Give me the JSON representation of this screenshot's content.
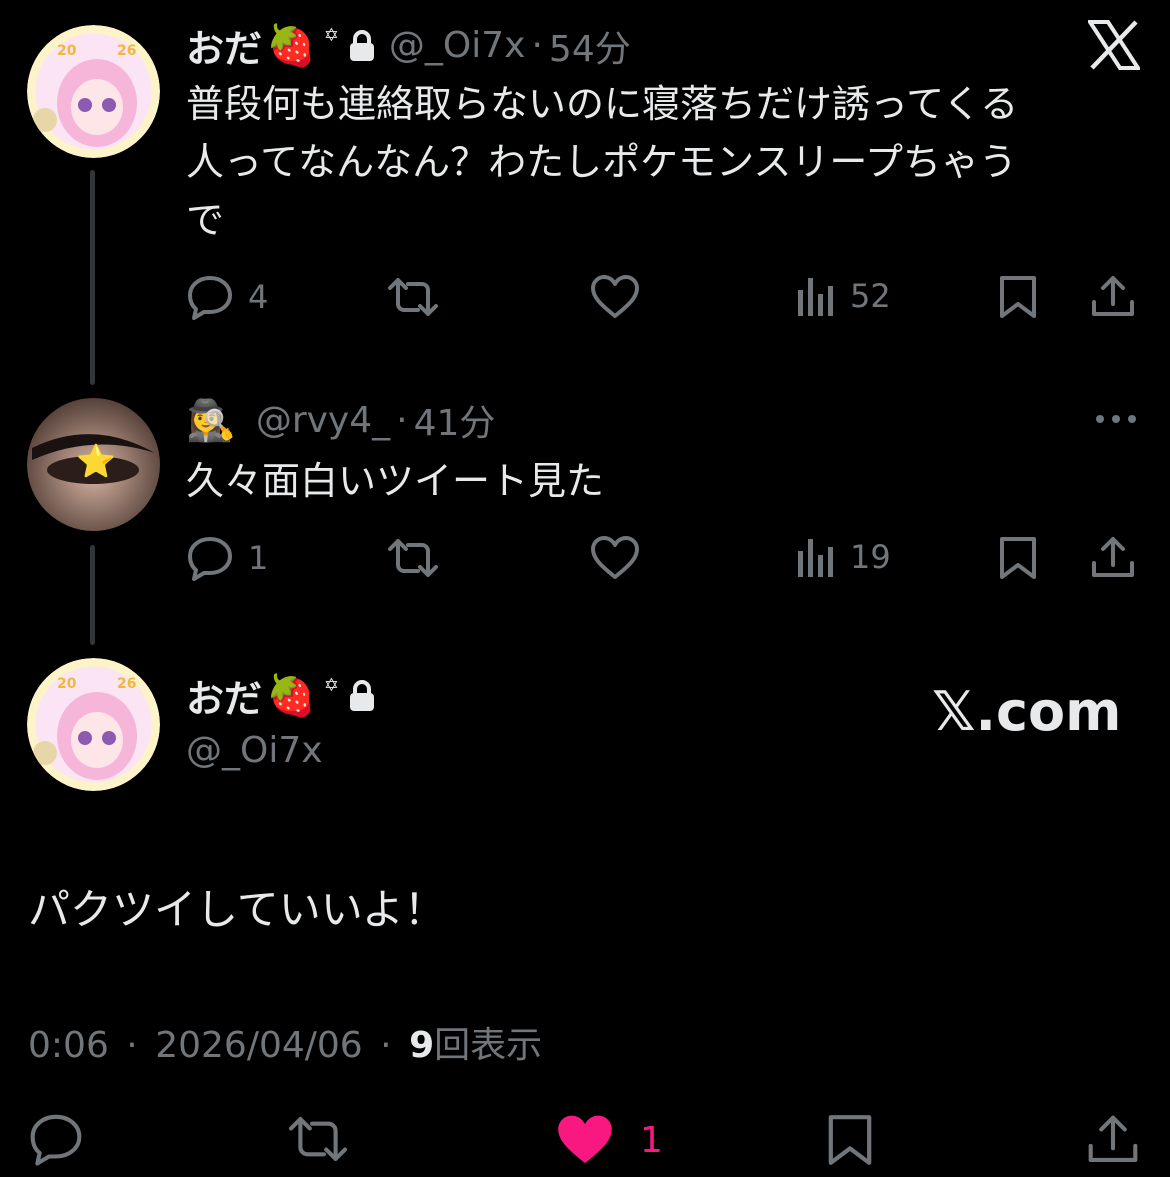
{
  "thread": [
    {
      "name": "おだ",
      "name_emoji": "🍓",
      "badge_glyph": "✡",
      "lock_icon": "lock-icon",
      "handle": "@_Oi7x",
      "separator": "·",
      "time": "54分",
      "text_lines": [
        "普段何も連絡取らないのに寝落ちだけ誘ってくる",
        "人ってなんなん？わたしポケモンスリープちゃう",
        "で"
      ],
      "reply_count": "4",
      "retweet_count": "",
      "like_count": "",
      "view_count": "52"
    },
    {
      "name_emoji": "🕵️‍♀️",
      "handle": "@rvy4_",
      "separator": "·",
      "time": "41分",
      "text": "久々面白いツイート見た",
      "reply_count": "1",
      "view_count": "19",
      "avatar_star": "⭐"
    }
  ],
  "main": {
    "name": "おだ",
    "name_emoji": "🍓",
    "badge_glyph": "✡",
    "handle": "@_Oi7x",
    "text": "パクツイしていいよ！",
    "time": "0:06",
    "date": "2026/04/06",
    "views": "9",
    "views_label": "回表示",
    "sep": "·",
    "like_count": "1",
    "watermark": "𝕏.com"
  },
  "colors": {
    "background": "#000000",
    "text": "#e7e9ea",
    "muted": "#71767b",
    "like_active": "#f91880",
    "line": "#333639"
  }
}
